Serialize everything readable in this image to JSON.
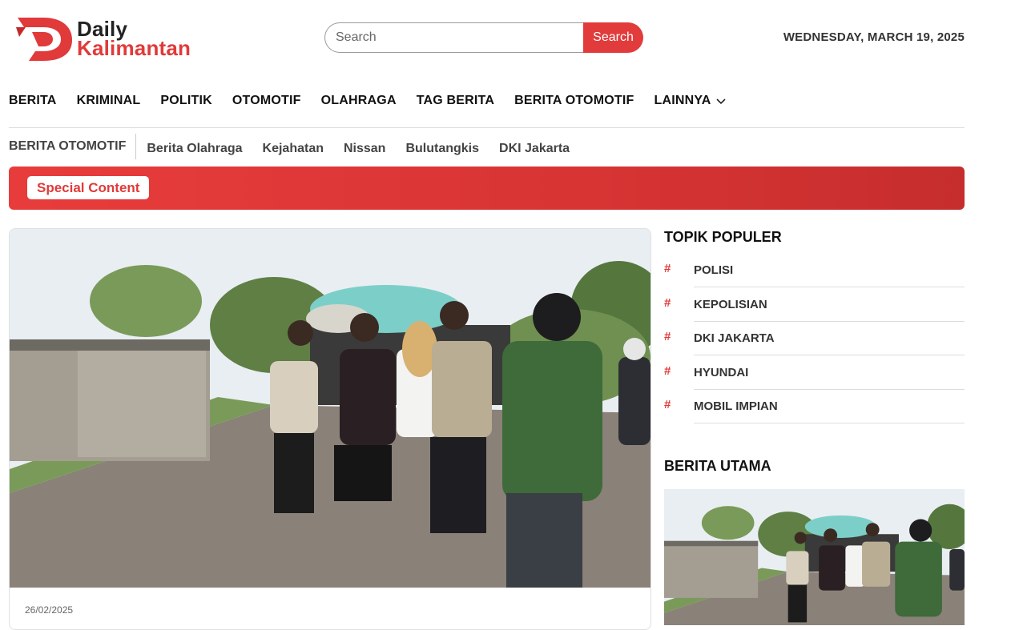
{
  "header": {
    "logo_line1": "Daily",
    "logo_line2": "Kalimantan",
    "search_placeholder": "Search",
    "search_button": "Search",
    "date": "WEDNESDAY, MARCH 19, 2025"
  },
  "main_nav": [
    {
      "label": "BERITA"
    },
    {
      "label": "KRIMINAL"
    },
    {
      "label": "POLITIK"
    },
    {
      "label": "OTOMOTIF"
    },
    {
      "label": "OLAHRAGA"
    },
    {
      "label": "TAG BERITA"
    },
    {
      "label": "BERITA OTOMOTIF"
    },
    {
      "label": "LAINNYA",
      "icon": "chevron-down-icon"
    }
  ],
  "sub_nav": {
    "first": "BERITA OTOMOTIF",
    "items": [
      "Berita Olahraga",
      "Kejahatan",
      "Nissan",
      "Bulutangkis",
      "DKI Jakarta"
    ]
  },
  "banner": {
    "badge": "Special Content"
  },
  "article": {
    "date": "26/02/2025"
  },
  "sidebar": {
    "topik_title": "TOPIK POPULER",
    "topik": [
      {
        "hash": "#",
        "label": "POLISI"
      },
      {
        "hash": "#",
        "label": "KEPOLISIAN"
      },
      {
        "hash": "#",
        "label": "DKI JAKARTA"
      },
      {
        "hash": "#",
        "label": "HYUNDAI"
      },
      {
        "hash": "#",
        "label": "MOBIL IMPIAN"
      }
    ],
    "utama_title": "BERITA UTAMA"
  },
  "colors": {
    "accent": "#e23b3b",
    "dark": "#111111"
  }
}
